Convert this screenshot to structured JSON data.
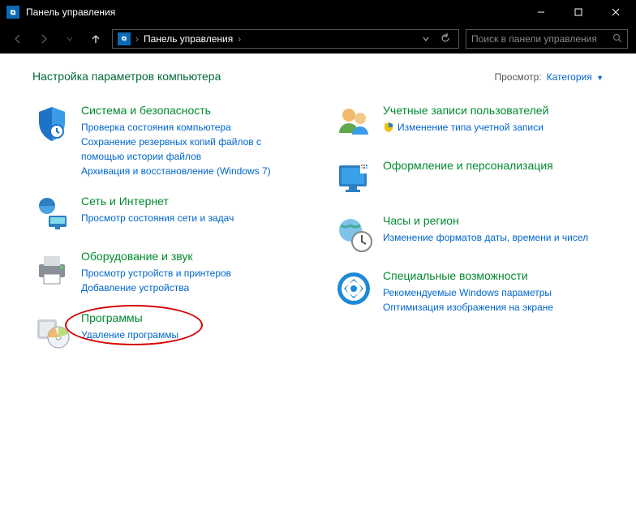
{
  "titlebar": {
    "title": "Панель управления"
  },
  "address": {
    "crumb1": "Панель управления"
  },
  "search": {
    "placeholder": "Поиск в панели управления"
  },
  "header": {
    "page_title": "Настройка параметров компьютера",
    "view_label": "Просмотр:",
    "view_value": "Категория"
  },
  "left": {
    "system": {
      "title": "Система и безопасность",
      "l1": "Проверка состояния компьютера",
      "l2": "Сохранение резервных копий файлов с помощью истории файлов",
      "l3": "Архивация и восстановление (Windows 7)"
    },
    "network": {
      "title": "Сеть и Интернет",
      "l1": "Просмотр состояния сети и задач"
    },
    "hardware": {
      "title": "Оборудование и звук",
      "l1": "Просмотр устройств и принтеров",
      "l2": "Добавление устройства"
    },
    "programs": {
      "title": "Программы",
      "l1": "Удаление программы"
    }
  },
  "right": {
    "accounts": {
      "title": "Учетные записи пользователей",
      "l1": "Изменение типа учетной записи"
    },
    "appearance": {
      "title": "Оформление и персонализация"
    },
    "clock": {
      "title": "Часы и регион",
      "l1": "Изменение форматов даты, времени и чисел"
    },
    "access": {
      "title": "Специальные возможности",
      "l1": "Рекомендуемые Windows параметры",
      "l2": "Оптимизация изображения на экране"
    }
  }
}
